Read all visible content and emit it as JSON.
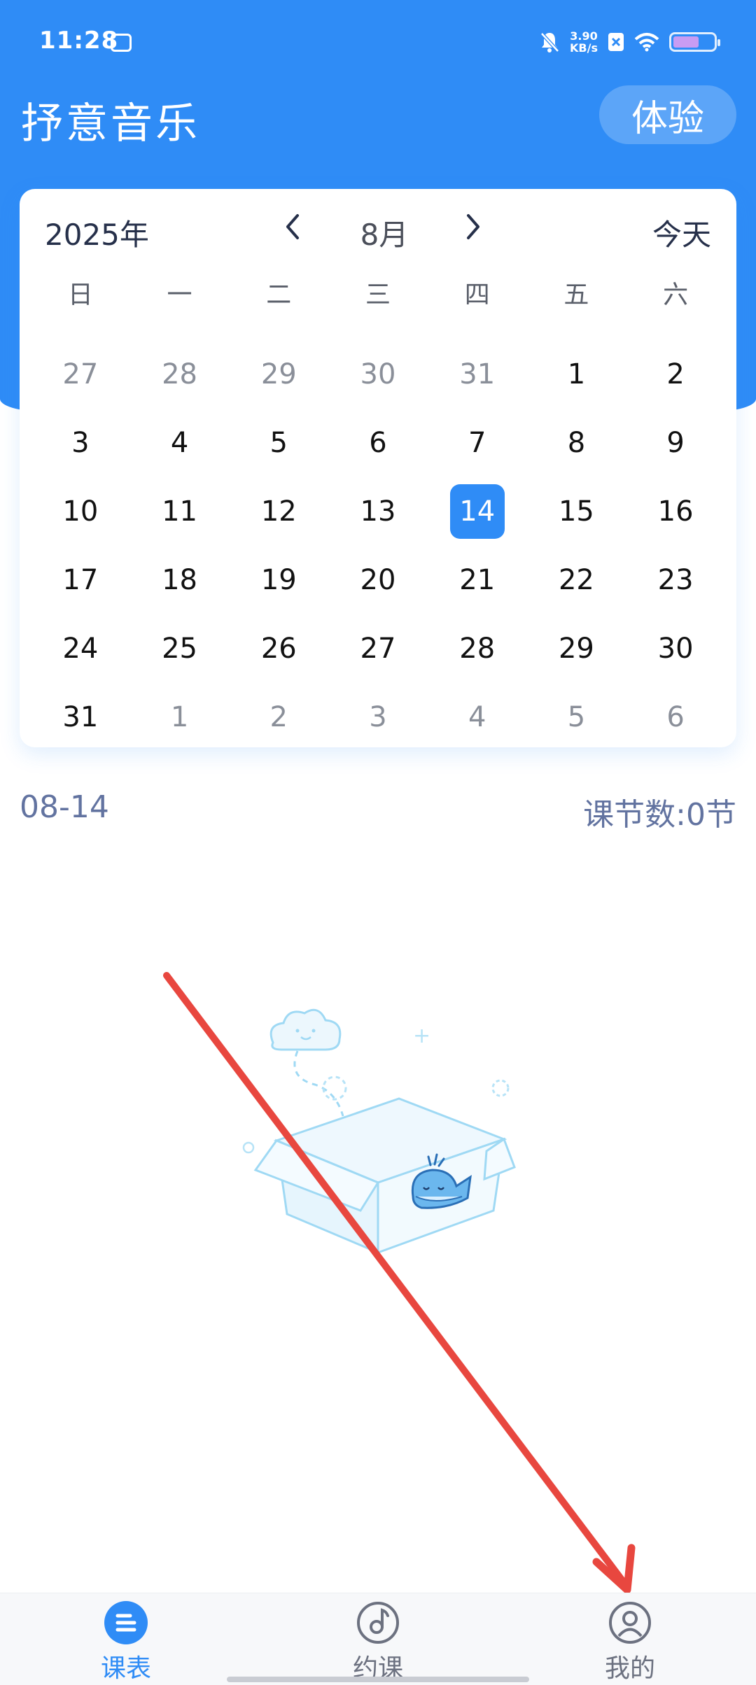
{
  "status_bar": {
    "time": "11:28",
    "net_speed_value": "3.90",
    "net_speed_unit": "KB/s",
    "battery_level": 0.65
  },
  "header": {
    "app_title": "抒意音乐",
    "trial_button": "体验"
  },
  "calendar": {
    "year_label": "2025年",
    "month_label": "8月",
    "today_button": "今天",
    "weekdays": [
      "日",
      "一",
      "二",
      "三",
      "四",
      "五",
      "六"
    ],
    "days": [
      {
        "label": "27",
        "muted": true
      },
      {
        "label": "28",
        "muted": true
      },
      {
        "label": "29",
        "muted": true
      },
      {
        "label": "30",
        "muted": true
      },
      {
        "label": "31",
        "muted": true
      },
      {
        "label": "1"
      },
      {
        "label": "2"
      },
      {
        "label": "3"
      },
      {
        "label": "4"
      },
      {
        "label": "5"
      },
      {
        "label": "6"
      },
      {
        "label": "7"
      },
      {
        "label": "8"
      },
      {
        "label": "9"
      },
      {
        "label": "10"
      },
      {
        "label": "11"
      },
      {
        "label": "12"
      },
      {
        "label": "13"
      },
      {
        "label": "14",
        "selected": true
      },
      {
        "label": "15"
      },
      {
        "label": "16"
      },
      {
        "label": "17"
      },
      {
        "label": "18"
      },
      {
        "label": "19"
      },
      {
        "label": "20"
      },
      {
        "label": "21"
      },
      {
        "label": "22"
      },
      {
        "label": "23"
      },
      {
        "label": "24"
      },
      {
        "label": "25"
      },
      {
        "label": "26"
      },
      {
        "label": "27"
      },
      {
        "label": "28"
      },
      {
        "label": "29"
      },
      {
        "label": "30"
      },
      {
        "label": "31"
      },
      {
        "label": "1",
        "muted": true
      },
      {
        "label": "2",
        "muted": true
      },
      {
        "label": "3",
        "muted": true
      },
      {
        "label": "4",
        "muted": true
      },
      {
        "label": "5",
        "muted": true
      },
      {
        "label": "6",
        "muted": true
      }
    ]
  },
  "schedule": {
    "date_label": "08-14",
    "lesson_count": "课节数:0节"
  },
  "tabbar": {
    "tabs": [
      {
        "label": "课表",
        "icon": "schedule-icon",
        "active": true
      },
      {
        "label": "约课",
        "icon": "music-note-icon",
        "active": false
      },
      {
        "label": "我的",
        "icon": "profile-icon",
        "active": false
      }
    ]
  },
  "colors": {
    "primary": "#2f8cf6",
    "annotation_arrow": "#e8473f"
  }
}
